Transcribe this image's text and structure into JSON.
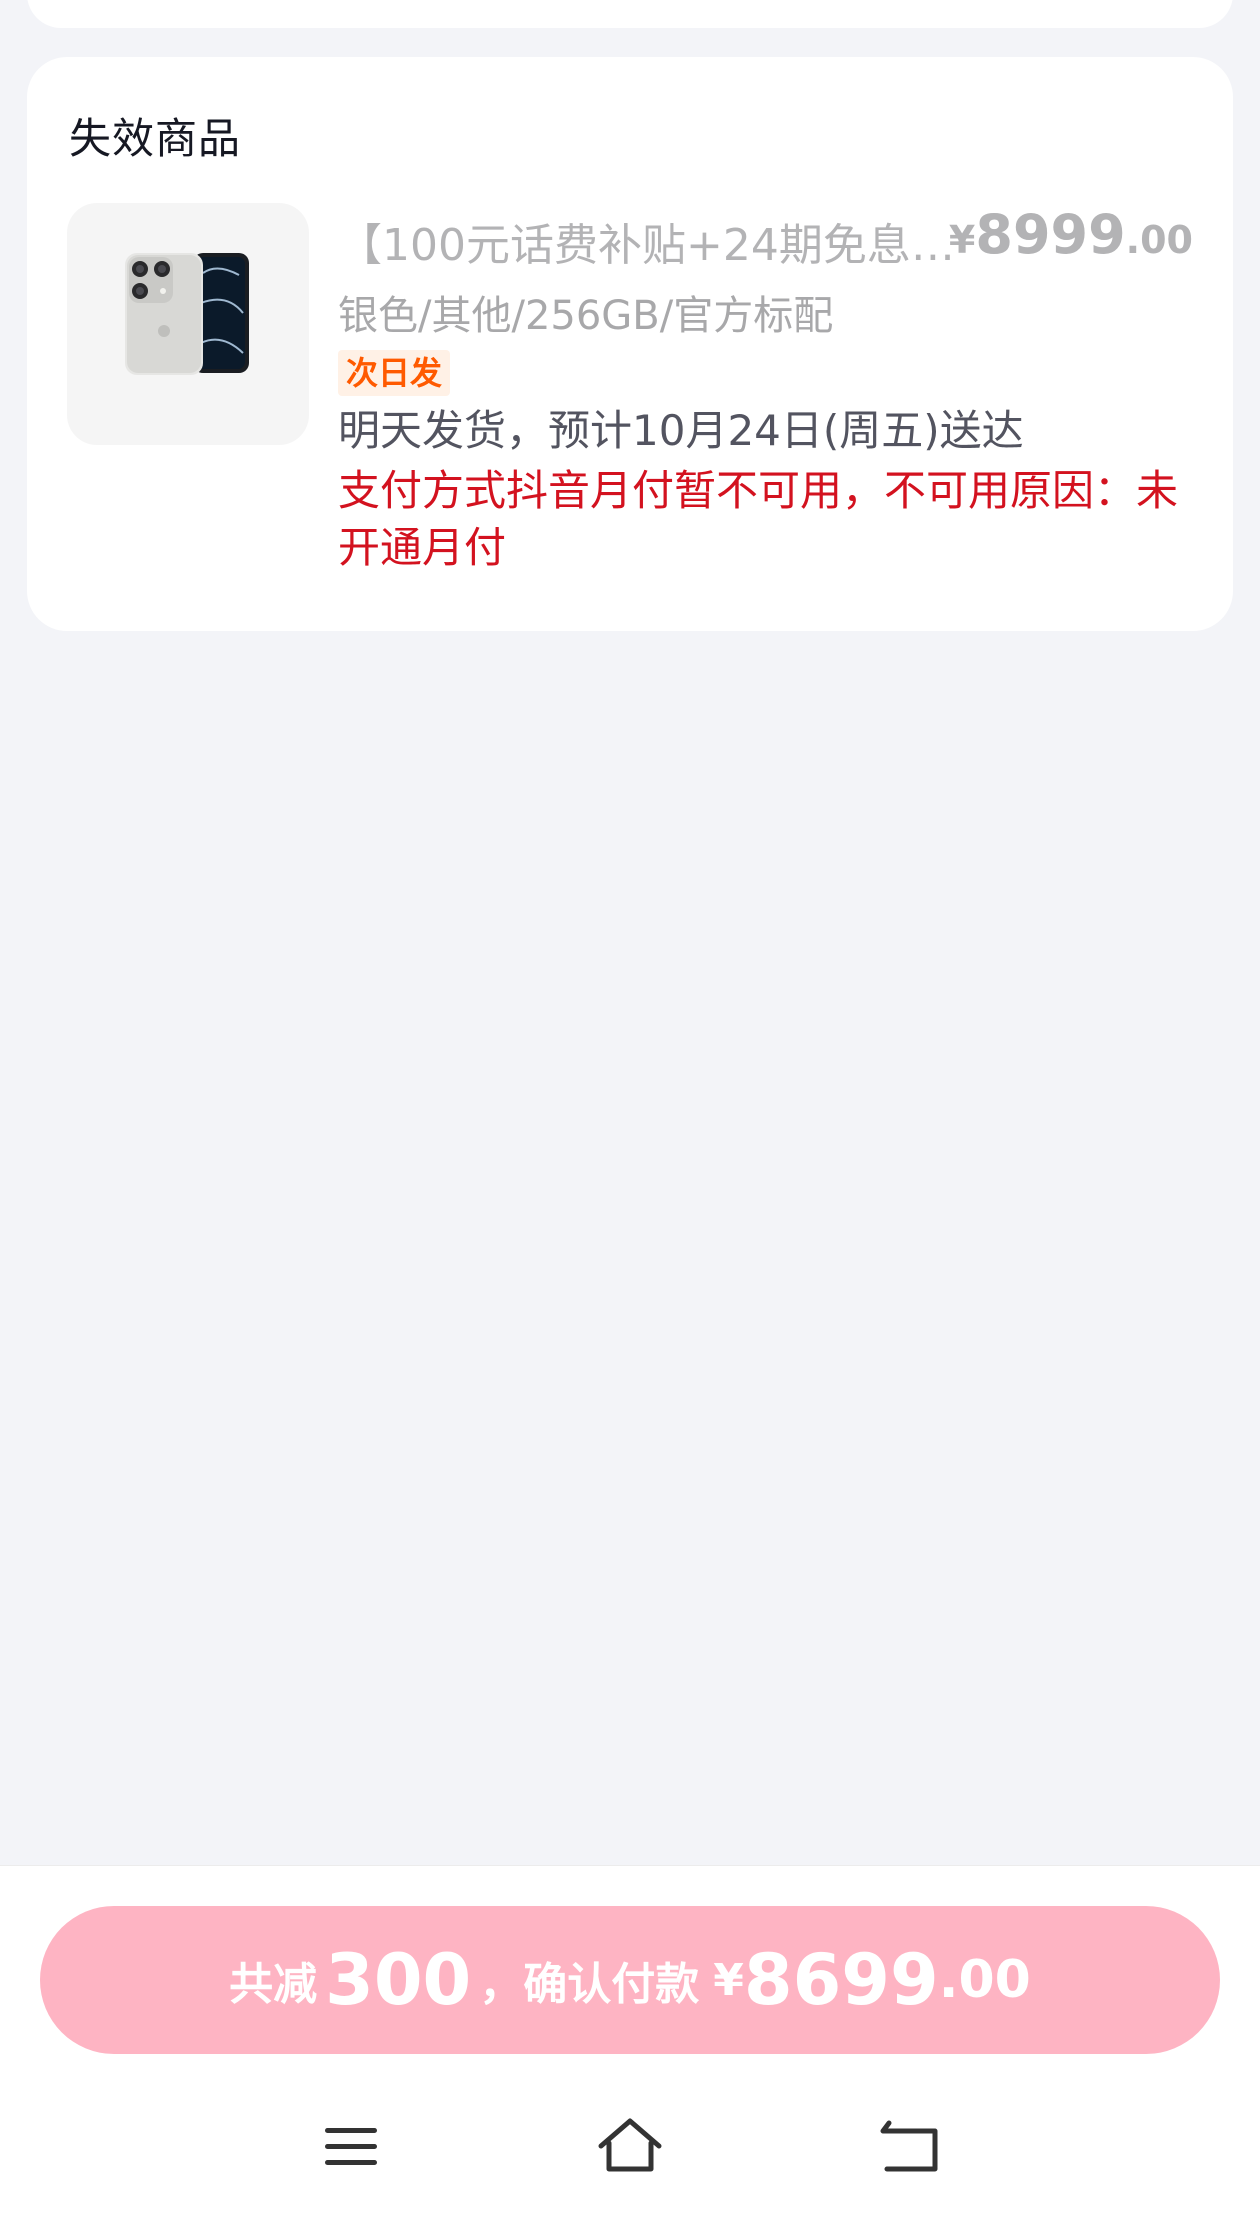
{
  "invalid_section": {
    "title": "失效商品",
    "product": {
      "title": "【100元话费补贴+24期免息…",
      "price": {
        "currency": "¥",
        "integer": "8999",
        "decimal": ".00"
      },
      "spec": "银色/其他/256GB/官方标配",
      "badge": "次日发",
      "shipping": "明天发货，预计10月24日(周五)送达",
      "reason": "支付方式抖音月付暂不可用，不可用原因：未开通月付",
      "image_icon": "phone-product-icon"
    }
  },
  "footer": {
    "discount_prefix": "共减",
    "discount_amount": "300",
    "confirm_text": "，确认付款",
    "currency": "¥",
    "total_integer": "8699",
    "total_decimal": ".00",
    "button_color": "#feb4c3"
  },
  "navigation": {
    "menu_icon": "menu-icon",
    "home_icon": "home-icon",
    "back_icon": "back-icon"
  },
  "colors": {
    "background": "#f3f4f8",
    "error_red": "#d3121f",
    "badge_orange": "#ff5a00"
  }
}
